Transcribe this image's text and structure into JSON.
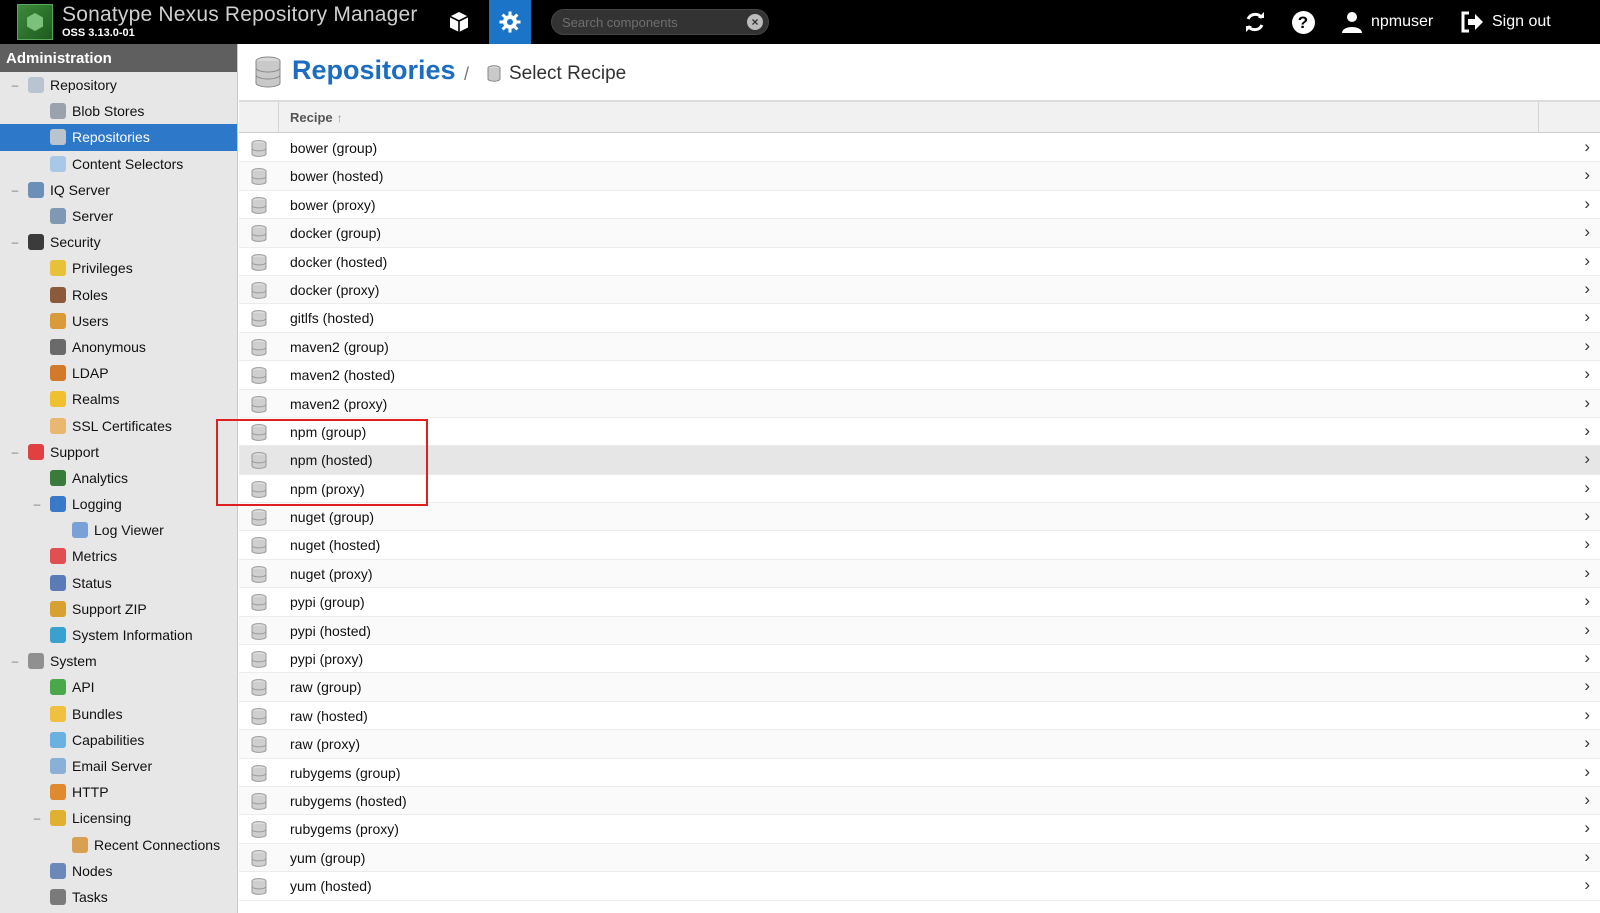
{
  "app": {
    "title": "Sonatype Nexus Repository Manager",
    "version": "OSS 3.13.0-01"
  },
  "topbar": {
    "search_placeholder": "Search components",
    "username": "npmuser",
    "signout_label": "Sign out",
    "accent_color": "#1c74c8"
  },
  "sidebar": {
    "header": "Administration",
    "items": [
      {
        "label": "Repository",
        "level": 0,
        "toggle": "–",
        "icon": "database-icon"
      },
      {
        "label": "Blob Stores",
        "level": 1,
        "icon": "blob-store-icon"
      },
      {
        "label": "Repositories",
        "level": 1,
        "icon": "database-icon",
        "selected": true
      },
      {
        "label": "Content Selectors",
        "level": 1,
        "icon": "content-selector-icon"
      },
      {
        "label": "IQ Server",
        "level": 0,
        "toggle": "–",
        "icon": "iq-server-icon"
      },
      {
        "label": "Server",
        "level": 1,
        "icon": "server-icon"
      },
      {
        "label": "Security",
        "level": 0,
        "toggle": "–",
        "icon": "security-icon"
      },
      {
        "label": "Privileges",
        "level": 1,
        "icon": "medal-icon"
      },
      {
        "label": "Roles",
        "level": 1,
        "icon": "role-icon"
      },
      {
        "label": "Users",
        "level": 1,
        "icon": "users-icon"
      },
      {
        "label": "Anonymous",
        "level": 1,
        "icon": "anonymous-icon"
      },
      {
        "label": "LDAP",
        "level": 1,
        "icon": "ldap-book-icon"
      },
      {
        "label": "Realms",
        "level": 1,
        "icon": "shield-icon"
      },
      {
        "label": "SSL Certificates",
        "level": 1,
        "icon": "certificate-icon"
      },
      {
        "label": "Support",
        "level": 0,
        "toggle": "–",
        "icon": "lifebuoy-icon"
      },
      {
        "label": "Analytics",
        "level": 1,
        "icon": "analytics-icon"
      },
      {
        "label": "Logging",
        "level": 1,
        "toggle": "–",
        "icon": "logging-icon"
      },
      {
        "label": "Log Viewer",
        "level": 2,
        "icon": "log-viewer-icon"
      },
      {
        "label": "Metrics",
        "level": 1,
        "icon": "pie-chart-icon"
      },
      {
        "label": "Status",
        "level": 1,
        "icon": "status-icon"
      },
      {
        "label": "Support ZIP",
        "level": 1,
        "icon": "zip-icon"
      },
      {
        "label": "System Information",
        "level": 1,
        "icon": "globe-icon"
      },
      {
        "label": "System",
        "level": 0,
        "toggle": "–",
        "icon": "gear-icon"
      },
      {
        "label": "API",
        "level": 1,
        "icon": "api-icon"
      },
      {
        "label": "Bundles",
        "level": 1,
        "icon": "puzzle-icon"
      },
      {
        "label": "Capabilities",
        "level": 1,
        "icon": "cube-icon"
      },
      {
        "label": "Email Server",
        "level": 1,
        "icon": "email-icon"
      },
      {
        "label": "HTTP",
        "level": 1,
        "icon": "truck-icon"
      },
      {
        "label": "Licensing",
        "level": 1,
        "toggle": "–",
        "icon": "license-icon"
      },
      {
        "label": "Recent Connections",
        "level": 2,
        "icon": "connections-icon"
      },
      {
        "label": "Nodes",
        "level": 1,
        "icon": "nodes-icon"
      },
      {
        "label": "Tasks",
        "level": 1,
        "icon": "tasks-icon"
      }
    ]
  },
  "page": {
    "title": "Repositories",
    "breadcrumb_separator": "/",
    "breadcrumb": "Select Recipe"
  },
  "grid": {
    "column_header": "Recipe",
    "sort_indicator": "↑",
    "rows": [
      "bower (group)",
      "bower (hosted)",
      "bower (proxy)",
      "docker (group)",
      "docker (hosted)",
      "docker (proxy)",
      "gitlfs (hosted)",
      "maven2 (group)",
      "maven2 (hosted)",
      "maven2 (proxy)",
      "npm (group)",
      "npm (hosted)",
      "npm (proxy)",
      "nuget (group)",
      "nuget (hosted)",
      "nuget (proxy)",
      "pypi (group)",
      "pypi (hosted)",
      "pypi (proxy)",
      "raw (group)",
      "raw (hosted)",
      "raw (proxy)",
      "rubygems (group)",
      "rubygems (hosted)",
      "rubygems (proxy)",
      "yum (group)",
      "yum (hosted)"
    ],
    "hover_row": "npm (hosted)",
    "chevron": "›"
  },
  "annotation": {
    "highlight_color": "#e02020"
  }
}
